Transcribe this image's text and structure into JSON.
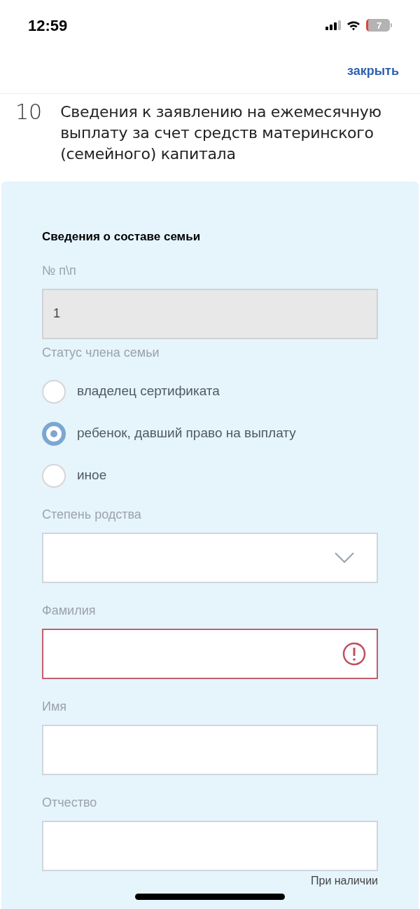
{
  "status_bar": {
    "time": "12:59",
    "battery": "7"
  },
  "header": {
    "close_link": "закрыть"
  },
  "step": {
    "number": "10",
    "title": "Сведения к заявлению на ежемесячную выплату за счет средств материнского (семейного) капитала"
  },
  "form": {
    "section_title": "Сведения о составе семьи",
    "fields": [
      {
        "kind": "text",
        "label": "№ п\\п",
        "value": "1",
        "disabled": true,
        "error": false
      },
      {
        "kind": "radio",
        "label": "Статус члена семьи",
        "options": [
          {
            "label": "владелец сертификата",
            "selected": false
          },
          {
            "label": "ребенок, давший право на выплату",
            "selected": true
          },
          {
            "label": "иное",
            "selected": false
          }
        ]
      },
      {
        "kind": "select",
        "label": "Степень родства",
        "disabled": false,
        "error": false
      },
      {
        "kind": "text",
        "label": "Фамилия",
        "disabled": false,
        "error": true
      },
      {
        "kind": "text",
        "label": "Имя",
        "disabled": false,
        "error": false
      },
      {
        "kind": "text",
        "label": "Отчество",
        "disabled": false,
        "error": false,
        "hint": "При наличии"
      }
    ]
  }
}
